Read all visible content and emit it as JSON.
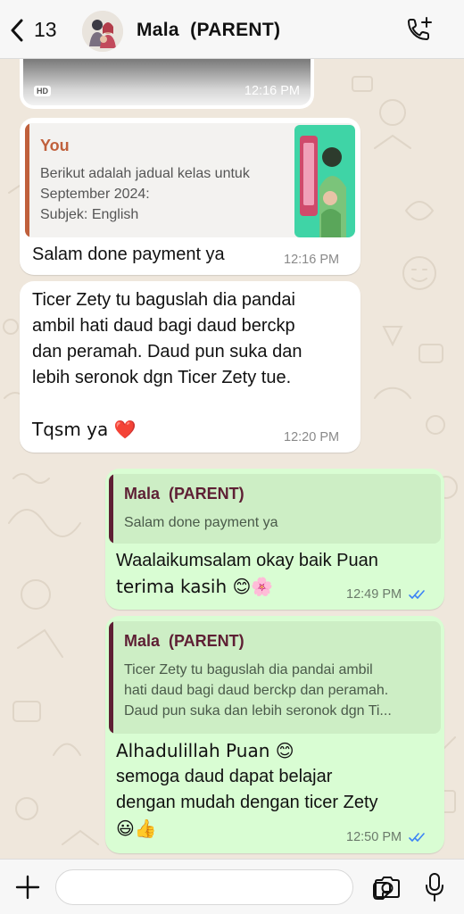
{
  "header": {
    "back_count": "13",
    "contact_name": "Mala  (PARENT)",
    "icons": [
      "chevron-left-icon",
      "avatar",
      "call-add-icon"
    ]
  },
  "messages": {
    "video": {
      "badge": "HD",
      "time": "12:16 PM"
    },
    "reply_you": {
      "quote_name": "You",
      "quote_lines": [
        "Berikut adalah jadual kelas untuk",
        "September 2024:",
        "Subjek: English"
      ],
      "text": "Salam done payment ya",
      "time": "12:16 PM"
    },
    "incoming2": {
      "lines": [
        "Ticer Zety tu baguslah dia pandai",
        "ambil hati daud bagi daud berckp",
        "dan peramah. Daud pun suka dan",
        "lebih seronok dgn Ticer Zety tue.",
        "",
        "Tqsm ya ❤️"
      ],
      "time": "12:20 PM"
    },
    "out1": {
      "quote_name": "Mala  (PARENT)",
      "quote_text": "Salam done payment ya",
      "lines": [
        "Waalaikumsalam okay baik Puan",
        "terima kasih 😊🌸"
      ],
      "time": "12:49 PM"
    },
    "out2": {
      "quote_name": "Mala  (PARENT)",
      "quote_lines": [
        "Ticer Zety tu baguslah dia pandai ambil",
        "hati daud bagi daud berckp dan peramah.",
        "Daud pun suka dan lebih seronok dgn Ti..."
      ],
      "lines": [
        "Alhadulillah Puan 😊",
        "semoga daud dapat belajar",
        "dengan mudah dengan ticer Zety",
        "😃👍"
      ],
      "time": "12:50 PM"
    }
  },
  "colors": {
    "chat_bg": "#efe7dc",
    "incoming": "#ffffff",
    "outgoing": "#d9fdd3",
    "you_accent": "#c0603c",
    "parent_accent": "#5e1f34",
    "read_ticks": "#3b82f6"
  },
  "bottom_bar": {
    "icons": [
      "plus-icon",
      "sticker-icon",
      "camera-icon",
      "microphone-icon"
    ],
    "input_placeholder": ""
  }
}
